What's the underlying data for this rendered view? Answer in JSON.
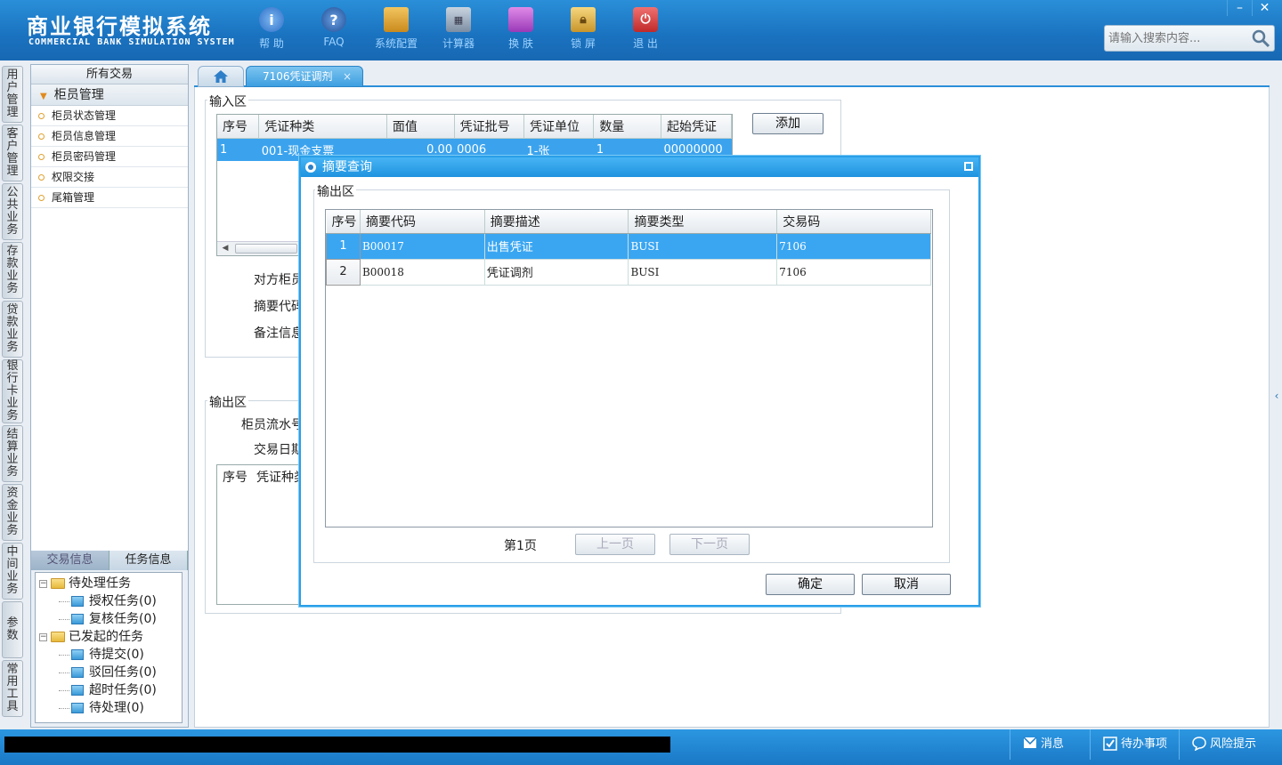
{
  "header": {
    "title": "商业银行模拟系统",
    "subtitle": "COMMERCIAL BANK SIMULATION SYSTEM",
    "toolbar": [
      {
        "label": "帮 助",
        "icon": "help-icon",
        "color": "#3a7fd8"
      },
      {
        "label": "FAQ",
        "icon": "faq-icon",
        "color": "#2a5fa8"
      },
      {
        "label": "系统配置",
        "icon": "toolbox-icon",
        "color": "#d9a430"
      },
      {
        "label": "计算器",
        "icon": "calculator-icon",
        "color": "#7a8fa8"
      },
      {
        "label": "换 肤",
        "icon": "shirt-icon",
        "color": "#c060d0"
      },
      {
        "label": "锁 屏",
        "icon": "lock-icon",
        "color": "#e6b84a"
      },
      {
        "label": "退 出",
        "icon": "power-icon",
        "color": "#d83a3a"
      }
    ],
    "search_placeholder": "请输入搜索内容...",
    "window_buttons": {
      "minimize": "–",
      "close": "✕"
    }
  },
  "vtabs": [
    "用户管理",
    "客户管理",
    "公共业务",
    "存款业务",
    "贷款业务",
    "银行卡业务",
    "结算业务",
    "资金业务",
    "中间业务",
    "参数",
    "常用工具"
  ],
  "leftpanel": {
    "header": "所有交易",
    "group": "柜员管理",
    "items": [
      "柜员状态管理",
      "柜员信息管理",
      "柜员密码管理",
      "权限交接",
      "尾箱管理"
    ],
    "bottom_tabs": [
      "交易信息",
      "任务信息"
    ],
    "tree": {
      "pending": "待处理任务",
      "pending_children": [
        "授权任务(0)",
        "复核任务(0)"
      ],
      "initiated": "已发起的任务",
      "initiated_children": [
        "待提交(0)",
        "驳回任务(0)",
        "超时任务(0)",
        "待处理(0)"
      ]
    }
  },
  "tabs": {
    "active": "7106凭证调剂",
    "close": "×"
  },
  "input_area": {
    "legend": "输入区",
    "columns": [
      "序号",
      "凭证种类",
      "面值",
      "凭证批号",
      "凭证单位",
      "数量",
      "起始凭证"
    ],
    "rows": [
      [
        "1",
        "001-现金支票",
        "0.00",
        "0006",
        "1-张",
        "1",
        "00000000"
      ]
    ],
    "add_button": "添加",
    "labels": [
      "对方柜员",
      "摘要代码",
      "备注信息"
    ]
  },
  "output_area": {
    "legend": "输出区",
    "labels": [
      "柜员流水号",
      "交易日期"
    ],
    "columns": [
      "序号",
      "凭证种类"
    ]
  },
  "dialog": {
    "title": "摘要查询",
    "legend": "输出区",
    "columns": [
      "序号",
      "摘要代码",
      "摘要描述",
      "摘要类型",
      "交易码"
    ],
    "rows": [
      {
        "seq": "1",
        "code": "B00017",
        "desc": "出售凭证",
        "type": "BUSI",
        "txcode": "7106"
      },
      {
        "seq": "2",
        "code": "B00018",
        "desc": "凭证调剂",
        "type": "BUSI",
        "txcode": "7106"
      }
    ],
    "page": "第1页",
    "prev": "上一页",
    "next": "下一页",
    "ok": "确定",
    "cancel": "取消"
  },
  "statusbar": {
    "message": "消息",
    "todo": "待办事项",
    "risk": "风险提示"
  }
}
